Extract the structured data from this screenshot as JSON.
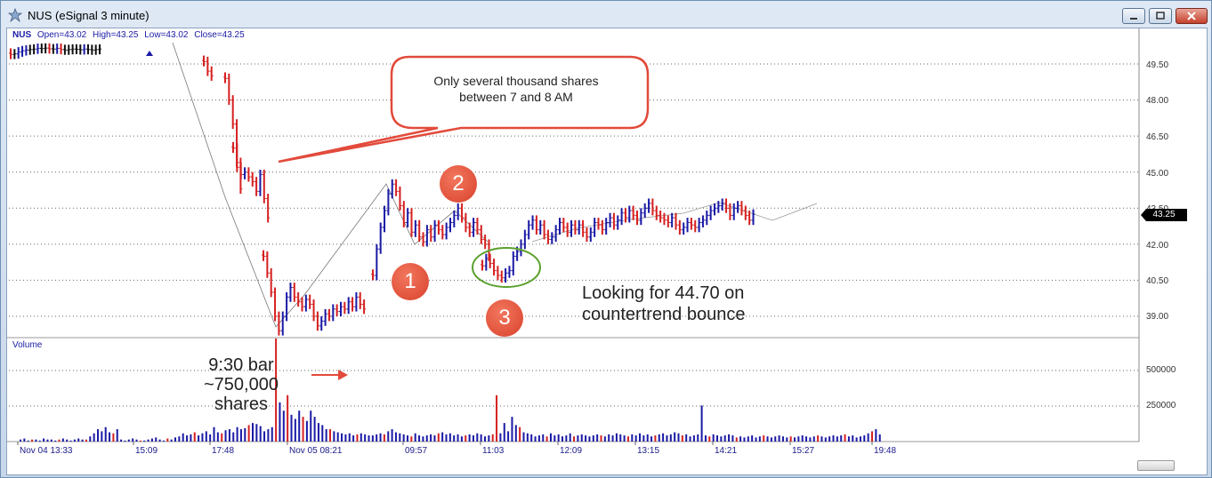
{
  "window": {
    "title": "NUS (eSignal 3 minute)"
  },
  "header": {
    "symbol": "NUS",
    "open": "Open=43.02",
    "high": "High=43.25",
    "low": "Low=43.02",
    "close": "Close=43.25"
  },
  "volume_pane_label": "Volume",
  "annotations": {
    "callout": "Only several thousand shares\nbetween 7 and 8 AM",
    "target": "Looking for 44.70 on\ncountertrend bounce",
    "volume_note": "9:30 bar\n~750,000\nshares",
    "markers": [
      "1",
      "2",
      "3"
    ]
  },
  "colors": {
    "up": "#1a1aa6",
    "down": "#d62020",
    "neutral": "#111111",
    "arrow": "#e24a3b",
    "circle": "#5aa02c"
  },
  "chart_data": {
    "type": "bar",
    "subtype": "ohlc-with-volume",
    "price_axis": {
      "ticks": [
        "49.50",
        "48.00",
        "46.50",
        "45.00",
        "43.50",
        "42.00",
        "40.50",
        "39.00"
      ],
      "last_price": "43.25"
    },
    "volume_axis": {
      "ticks": [
        "500000",
        "250000"
      ]
    },
    "x_ticks": [
      "Nov 04 13:33",
      "15:09",
      "17:48",
      "Nov 05 08:21",
      "09:57",
      "11:03",
      "12:09",
      "13:15",
      "14:21",
      "15:27",
      "19:48"
    ],
    "grid": true,
    "price_series": [
      [
        49.9,
        49.92,
        50.0,
        50.05,
        50.08,
        50.1,
        50.12,
        50.15,
        50.14,
        50.16,
        50.13,
        50.12,
        50.15,
        50.1,
        50.08,
        50.1,
        50.12,
        50.11,
        50.09,
        50.12,
        50.1,
        50.08,
        50.1,
        50.12
      ],
      [
        49.6,
        49.2,
        49.0
      ],
      [
        48.9,
        48.0,
        47.0,
        45.4,
        44.3
      ],
      [
        46.0,
        45.2,
        44.9,
        45.0,
        44.8,
        44.6,
        44.2,
        44.9,
        43.9,
        43.1
      ],
      [
        41.5,
        40.8,
        40.0,
        39.0,
        38.4,
        39.0,
        39.8,
        40.2,
        39.8,
        39.6,
        39.4,
        39.7,
        39.5,
        39.0,
        38.6,
        38.8,
        39.1,
        39.0,
        39.3,
        39.2,
        39.4,
        39.3,
        39.6,
        39.4,
        39.8,
        39.5,
        39.3
      ],
      [
        40.7,
        41.8,
        42.7,
        43.4,
        44.1,
        44.5,
        44.2,
        43.6,
        42.9,
        43.3,
        42.5,
        42.8,
        42.3,
        42.1,
        42.6,
        42.3,
        42.8,
        42.6,
        42.4,
        42.7,
        42.9,
        43.2,
        43.5,
        43.1,
        42.7,
        42.5,
        42.9,
        42.6,
        42.2,
        42.0,
        41.5
      ],
      [
        41.1,
        41.4,
        41.2,
        40.9,
        40.7,
        40.6,
        40.8,
        40.9,
        41.5,
        41.7,
        42.0,
        42.4,
        42.8,
        43.0,
        42.6,
        42.8,
        42.4,
        42.2,
        42.3,
        42.6,
        42.9,
        42.7,
        42.5,
        42.8,
        42.6,
        42.8,
        42.5,
        42.3,
        42.5,
        42.9,
        42.8,
        42.6,
        42.9,
        43.1,
        42.8,
        43.0,
        43.3,
        43.1,
        43.4,
        43.2,
        43.0,
        43.3,
        43.5,
        43.7,
        43.4,
        43.2,
        43.1,
        43.0,
        42.9,
        43.1,
        42.8,
        42.6,
        42.7,
        42.9,
        42.8,
        42.7,
        42.9,
        43.0,
        43.2,
        43.4,
        43.5,
        43.6,
        43.7,
        43.5,
        43.2,
        43.5,
        43.6,
        43.4,
        43.2,
        43.0,
        43.25
      ]
    ],
    "volume_series": [
      2,
      3,
      1,
      2,
      2,
      1,
      3,
      2,
      2,
      1,
      2,
      3,
      2,
      1,
      2,
      3,
      2,
      2,
      5,
      8,
      12,
      10,
      14,
      9,
      8,
      12,
      2,
      1,
      2,
      3,
      2,
      1,
      1,
      2,
      3,
      4,
      2,
      1,
      3,
      2,
      4,
      5,
      8,
      6,
      7,
      9,
      6,
      8,
      10,
      7,
      14,
      9,
      8,
      11,
      12,
      9,
      14,
      12,
      13,
      16,
      18,
      17,
      15,
      10,
      12,
      14,
      100,
      38,
      30,
      45,
      26,
      22,
      30,
      24,
      20,
      30,
      24,
      18,
      16,
      12,
      12,
      10,
      9,
      8,
      7,
      8,
      6,
      7,
      8,
      7,
      6,
      6,
      7,
      8,
      7,
      10,
      12,
      9,
      8,
      7,
      6,
      5,
      8,
      6,
      5,
      6,
      7,
      6,
      8,
      9,
      7,
      8,
      6,
      7,
      5,
      6,
      7,
      6,
      8,
      7,
      5,
      6,
      7,
      45,
      8,
      18,
      10,
      24,
      16,
      14,
      9,
      8,
      7,
      5,
      6,
      7,
      5,
      8,
      6,
      7,
      5,
      6,
      8,
      5,
      6,
      7,
      6,
      5,
      6,
      7,
      6,
      5,
      7,
      6,
      8,
      7,
      6,
      5,
      7,
      6,
      8,
      6,
      7,
      5,
      6,
      7,
      8,
      6,
      7,
      9,
      8,
      6,
      7,
      5,
      6,
      7,
      35,
      6,
      5,
      7,
      6,
      5,
      6,
      7,
      6,
      4,
      5,
      4,
      5,
      6,
      4,
      5,
      6,
      5,
      4,
      5,
      6,
      5,
      4,
      5,
      4,
      5,
      6,
      5,
      4,
      5,
      6,
      5,
      4,
      5,
      6,
      5,
      6,
      7,
      5,
      6,
      4,
      5,
      6,
      8,
      10,
      12,
      7
    ]
  }
}
